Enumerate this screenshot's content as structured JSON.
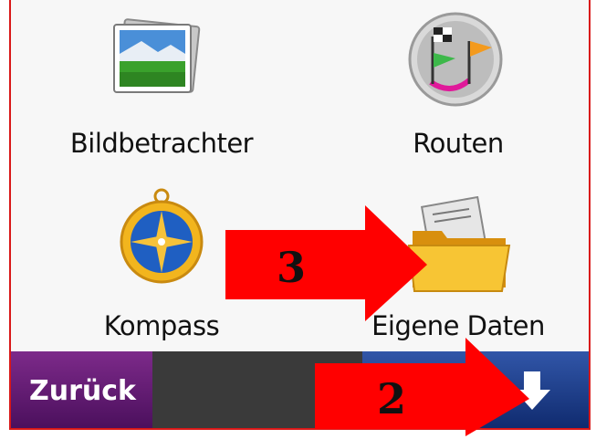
{
  "menu": {
    "items": [
      {
        "label": "Bildbetrachter",
        "icon": "photo-viewer-icon"
      },
      {
        "label": "Routen",
        "icon": "routes-flags-icon"
      },
      {
        "label": "Kompass",
        "icon": "compass-icon"
      },
      {
        "label": "Eigene Daten",
        "icon": "folder-icon"
      }
    ]
  },
  "bottombar": {
    "back_label": "Zurück",
    "down_icon": "down-arrow-icon"
  },
  "annotations": {
    "step_3": "3",
    "step_2": "2"
  },
  "colors": {
    "frame_border": "#d91818",
    "back_button": "#6a1f7a",
    "down_button": "#1e3f8f",
    "annotation_arrow": "#ff0000"
  }
}
